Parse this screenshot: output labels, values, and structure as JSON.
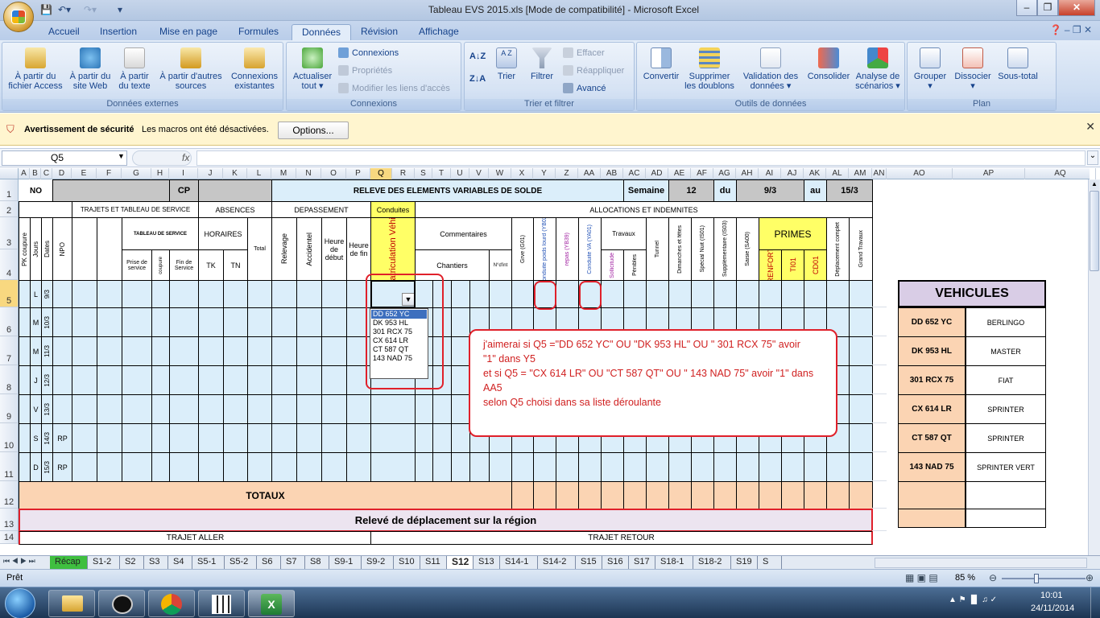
{
  "window": {
    "title": "Tableau EVS 2015.xls  [Mode de compatibilité] - Microsoft Excel"
  },
  "ribbon_tabs": [
    "Accueil",
    "Insertion",
    "Mise en page",
    "Formules",
    "Données",
    "Révision",
    "Affichage"
  ],
  "ribbon": {
    "groups": [
      "Données externes",
      "Connexions",
      "Trier et filtrer",
      "Outils de données",
      "Plan"
    ],
    "access": "À partir du fichier Access",
    "web": "À partir du site Web",
    "text": "À partir du texte",
    "other": "À partir d'autres sources",
    "existing": "Connexions existantes",
    "refresh": "Actualiser tout",
    "connections": "Connexions",
    "properties": "Propriétés",
    "edit_links": "Modifier les liens d'accès",
    "sort_az": "A Z",
    "trier": "Trier",
    "filtrer": "Filtrer",
    "effacer": "Effacer",
    "reappliquer": "Réappliquer",
    "avance": "Avancé",
    "convertir": "Convertir",
    "doublons": "Supprimer les doublons",
    "validation": "Validation des données",
    "consolider": "Consolider",
    "scenarios": "Analyse de scénarios",
    "grouper": "Grouper",
    "dissocier": "Dissocier",
    "soustotal": "Sous-total"
  },
  "security": {
    "title": "Avertissement de sécurité",
    "message": "Les macros ont été désactivées.",
    "options": "Options..."
  },
  "formula_bar": {
    "name_box": "Q5",
    "fx": "fx",
    "value": ""
  },
  "columns": [
    "A",
    "B",
    "C",
    "D",
    "E",
    "F",
    "G",
    "H",
    "I",
    "J",
    "K",
    "L",
    "M",
    "N",
    "O",
    "P",
    "Q",
    "R",
    "S",
    "T",
    "U",
    "V",
    "W",
    "X",
    "Y",
    "Z",
    "AA",
    "AB",
    "AC",
    "AD",
    "AE",
    "AF",
    "AG",
    "AH",
    "AI",
    "AJ",
    "AK",
    "AL",
    "AM",
    "AN",
    "AO",
    "AP",
    "AQ"
  ],
  "rows": [
    "1",
    "2",
    "3",
    "4",
    "5",
    "6",
    "7",
    "8",
    "9",
    "10",
    "11",
    "12",
    "13",
    "14"
  ],
  "sheet": {
    "nom": "NOM",
    "cp": "CP",
    "releve": "RELEVE DES ELEMENTS VARIABLES DE SOLDE",
    "semaine": "Semaine",
    "semaine_val": "12",
    "du": "du",
    "du_val": "9/3",
    "au": "au",
    "au_val": "15/3",
    "trajets": "TRAJETS ET TABLEAU DE SERVICE",
    "absences": "ABSENCES",
    "depassement": "DEPASSEMENT",
    "conduites": "Conduites",
    "allocations": "ALLOCATIONS ET INDEMNITES",
    "tableau": "TABLEAU DE SERVICE",
    "horaires": "HORAIRES",
    "commentaires": "Commentaires",
    "travaux": "Travaux",
    "primes": "PRIMES",
    "pk": "PK coupure",
    "jours": "Jours",
    "dates": "Dates",
    "npo": "NPO",
    "prise": "Prise de service",
    "coupure": "coupure",
    "fin": "Fin de Service",
    "tk": "TK",
    "tn": "TN",
    "total": "Total",
    "relevage": "Relevage",
    "accidentel": "Accidentel",
    "heure_debut": "Heure de début",
    "heure_fin": "Heure de fin",
    "immat": "Immatriculation Véhicule",
    "chantiers": "Chantiers",
    "nint": "N°d'int",
    "greve": "Grve (G01)",
    "poids_lourd": "Conduite poids lourd (YB02)",
    "repas": "repas (YB39)",
    "conduite_va": "Conduite VA (YA01)",
    "sollicitude": "Sollicitude",
    "penibles": "Pénibles",
    "tunnel": "Tunnel",
    "dimanches": "Dimanches et fêtes",
    "nuit": "Spécial Nuit (IS01)",
    "supplementaire": "Supplémentaire (IS03)",
    "saisie": "Saisie (SA00)",
    "renfort": "RENFORT",
    "ti01": "TI01",
    "cd01": "CD01",
    "deplacement": "Déplacement complet",
    "grand_travaux": "Grand Travaux",
    "day_rows": [
      {
        "jour": "L",
        "date": "9/3",
        "npo": ""
      },
      {
        "jour": "M",
        "date": "10/3",
        "npo": ""
      },
      {
        "jour": "M",
        "date": "11/3",
        "npo": ""
      },
      {
        "jour": "J",
        "date": "12/3",
        "npo": ""
      },
      {
        "jour": "V",
        "date": "13/3",
        "npo": ""
      },
      {
        "jour": "S",
        "date": "14/3",
        "npo": "RP"
      },
      {
        "jour": "D",
        "date": "15/3",
        "npo": "RP"
      }
    ],
    "totaux": "TOTAUX",
    "releve_deplacement": "Relevé de déplacement sur la région",
    "trajet_aller": "TRAJET ALLER",
    "trajet_retour": "TRAJET RETOUR"
  },
  "dropdown": [
    "DD 652 YC",
    "DK 953 HL",
    "301 RCX 75",
    "CX 614 LR",
    "CT 587 QT",
    "143 NAD 75"
  ],
  "vehicules": {
    "title": "VEHICULES",
    "rows": [
      [
        "DD 652 YC",
        "BERLINGO"
      ],
      [
        "DK 953 HL",
        "MASTER"
      ],
      [
        "301 RCX 75",
        "FIAT"
      ],
      [
        "CX 614 LR",
        "SPRINTER"
      ],
      [
        "CT 587 QT",
        "SPRINTER"
      ],
      [
        "143 NAD 75",
        "SPRINTER VERT"
      ]
    ]
  },
  "comment_lines": [
    "j'aimerai si Q5 =\"DD 652 YC\" OU \"DK 953 HL\" OU \" 301 RCX 75\"  avoir",
    "\"1\" dans Y5",
    "et  si Q5 = \"CX 614 LR\" OU \"CT 587 QT\" OU \" 143 NAD 75\" avoir \"1\" dans",
    "AA5",
    "selon Q5 choisi dans sa liste déroulante"
  ],
  "sheet_tabs": [
    "Récap",
    "S1-2",
    "S2",
    "S3",
    "S4",
    "S5-1",
    "S5-2",
    "S6",
    "S7",
    "S8",
    "S9-1",
    "S9-2",
    "S10",
    "S11",
    "S12",
    "S13",
    "S14-1",
    "S14-2",
    "S15",
    "S16",
    "S17",
    "S18-1",
    "S18-2",
    "S19",
    "S"
  ],
  "status": {
    "ready": "Prêt",
    "zoom": "85 %"
  },
  "clock": {
    "time": "10:01",
    "date": "24/11/2014"
  },
  "colors": {
    "blue_rows": "#dbeefa",
    "peach": "#fbd4b3",
    "yellow": "#ffff66",
    "red": "#e0202a",
    "vehicules_title": "#d9cde6"
  }
}
